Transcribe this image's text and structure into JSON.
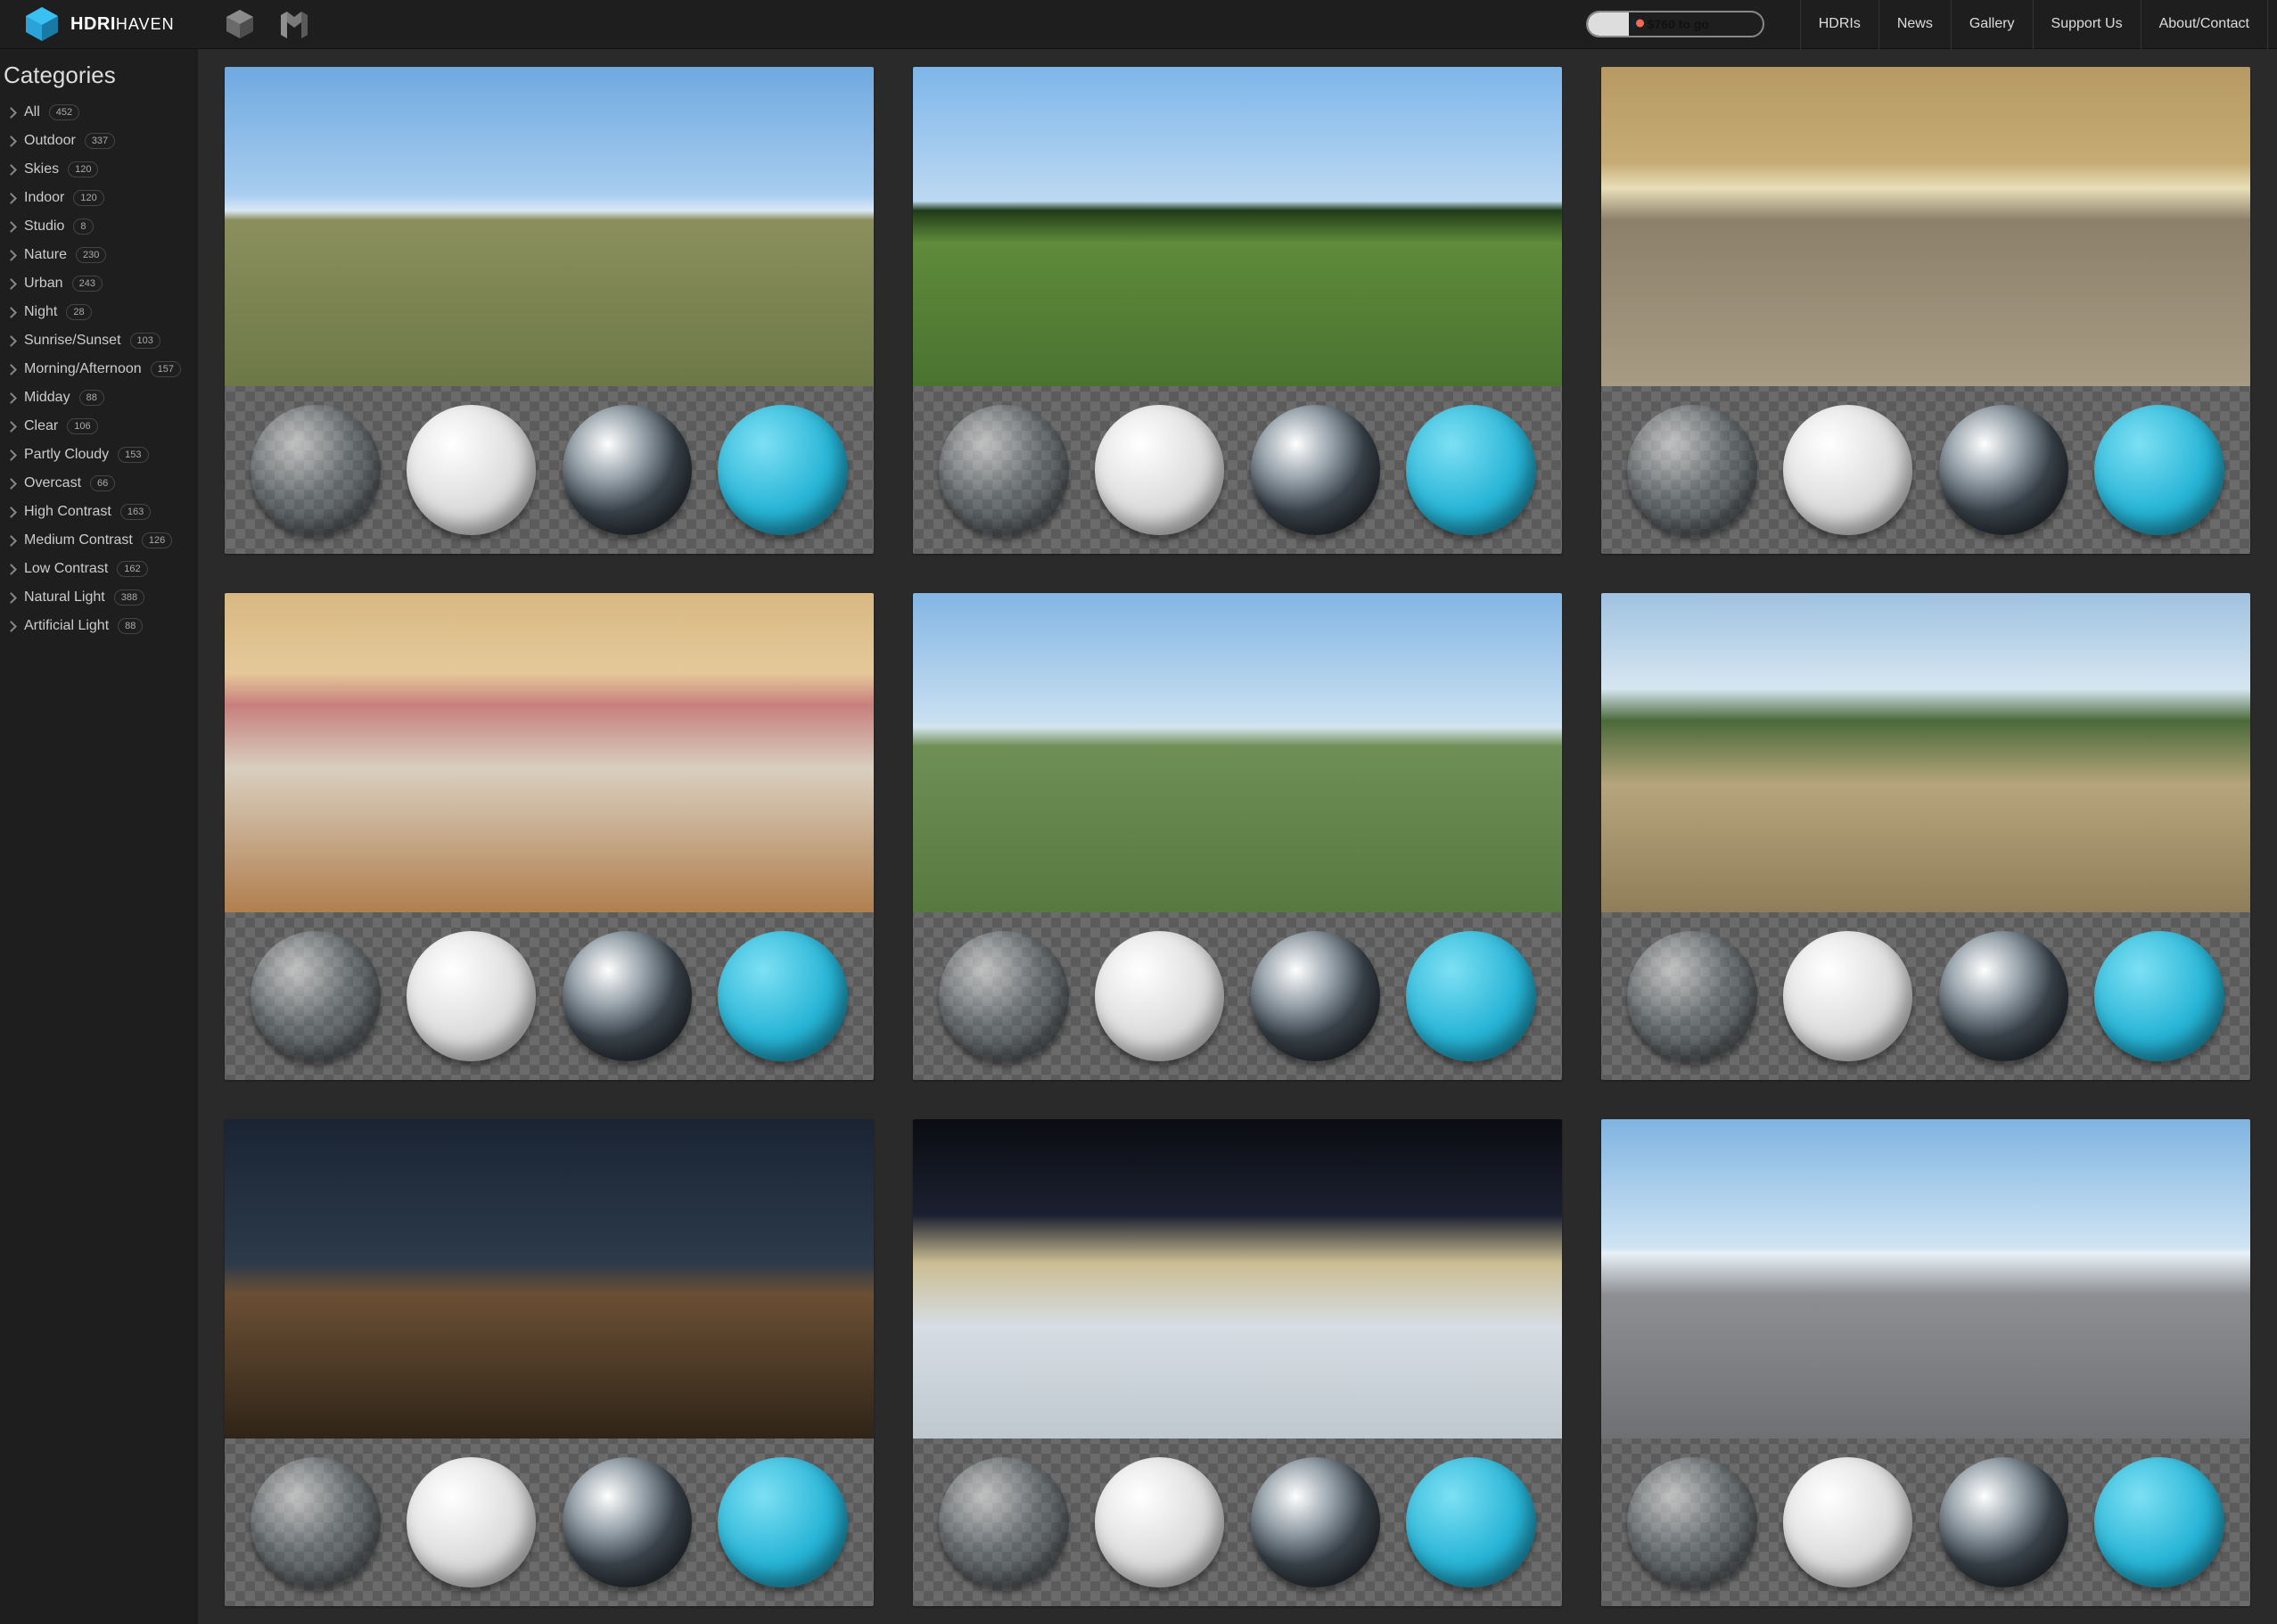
{
  "brand": {
    "word1": "HDRI",
    "word2": "HAVEN"
  },
  "donation": {
    "text": "$760 to go"
  },
  "nav": [
    "HDRIs",
    "News",
    "Gallery",
    "Support Us",
    "About/Contact"
  ],
  "sidebar": {
    "title": "Categories",
    "items": [
      {
        "label": "All",
        "count": "452"
      },
      {
        "label": "Outdoor",
        "count": "337"
      },
      {
        "label": "Skies",
        "count": "120"
      },
      {
        "label": "Indoor",
        "count": "120"
      },
      {
        "label": "Studio",
        "count": "8"
      },
      {
        "label": "Nature",
        "count": "230"
      },
      {
        "label": "Urban",
        "count": "243"
      },
      {
        "label": "Night",
        "count": "28"
      },
      {
        "label": "Sunrise/Sunset",
        "count": "103"
      },
      {
        "label": "Morning/Afternoon",
        "count": "157"
      },
      {
        "label": "Midday",
        "count": "88"
      },
      {
        "label": "Clear",
        "count": "106"
      },
      {
        "label": "Partly Cloudy",
        "count": "153"
      },
      {
        "label": "Overcast",
        "count": "66"
      },
      {
        "label": "High Contrast",
        "count": "163"
      },
      {
        "label": "Medium Contrast",
        "count": "126"
      },
      {
        "label": "Low Contrast",
        "count": "162"
      },
      {
        "label": "Natural Light",
        "count": "388"
      },
      {
        "label": "Artificial Light",
        "count": "88"
      }
    ]
  },
  "cards": [
    {
      "look": "sky"
    },
    {
      "look": "field"
    },
    {
      "look": "warehouse"
    },
    {
      "look": "interior"
    },
    {
      "look": "hills"
    },
    {
      "look": "trail"
    },
    {
      "look": "dusk"
    },
    {
      "look": "snow"
    },
    {
      "look": "road"
    }
  ]
}
